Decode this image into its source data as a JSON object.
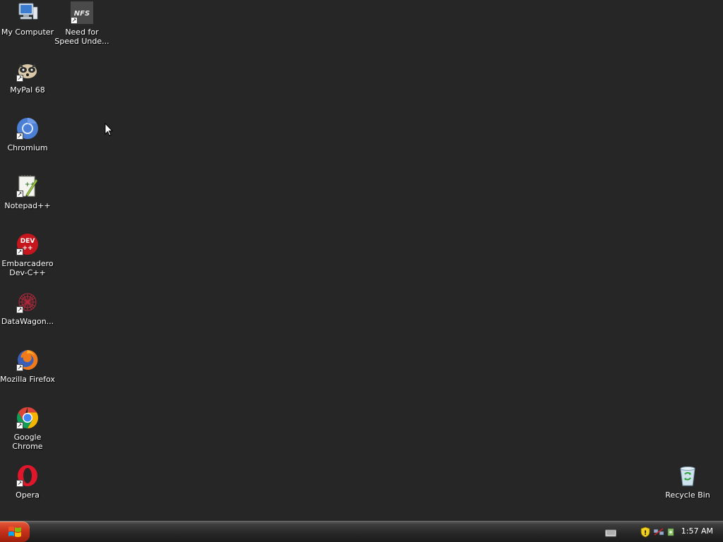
{
  "desktop": {
    "icons": [
      {
        "label": "My Computer",
        "name": "my-computer-icon"
      },
      {
        "label": "Need for Speed Unde...",
        "name": "need-for-speed-icon"
      },
      {
        "label": "MyPal 68",
        "name": "mypal-icon"
      },
      {
        "label": "Chromium",
        "name": "chromium-icon"
      },
      {
        "label": "Notepad++",
        "name": "notepadpp-icon"
      },
      {
        "label": "Embarcadero Dev-C++",
        "name": "devcpp-icon"
      },
      {
        "label": "DataWagon...",
        "name": "datawagon-icon"
      },
      {
        "label": "Mozilla Firefox",
        "name": "firefox-icon"
      },
      {
        "label": "Google Chrome",
        "name": "chrome-icon"
      },
      {
        "label": "Opera",
        "name": "opera-icon"
      },
      {
        "label": "Recycle Bin",
        "name": "recycle-bin-icon"
      }
    ]
  },
  "taskbar": {
    "clock": "1:57 AM",
    "start_icon": "windows-logo-icon",
    "tray_icons": [
      "keyboard-icon",
      "security-shield-icon",
      "network-icon",
      "safely-remove-icon"
    ]
  },
  "colors": {
    "desktop_bg": "#262626",
    "start_button": "#c8321b",
    "taskbar": "#262626"
  }
}
